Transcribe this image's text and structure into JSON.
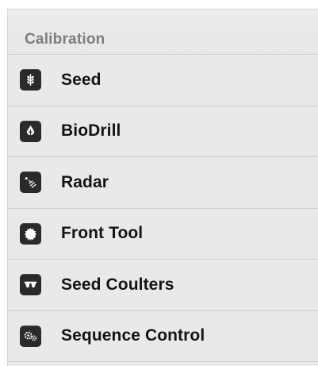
{
  "sidebar": {
    "section_title": "Calibration",
    "items": [
      {
        "label": "Seed",
        "icon": "wheat-icon"
      },
      {
        "label": "BioDrill",
        "icon": "drop-icon"
      },
      {
        "label": "Radar",
        "icon": "radar-icon"
      },
      {
        "label": "Front Tool",
        "icon": "gear-blade-icon"
      },
      {
        "label": "Seed Coulters",
        "icon": "coulter-icon"
      },
      {
        "label": "Sequence Control",
        "icon": "gears-icon"
      }
    ]
  },
  "colors": {
    "panel_background": "#e9e9e9",
    "header_text": "#7d7d7d",
    "item_text": "#141414",
    "icon_background": "#2a2a2a",
    "divider": "#d0d0d0"
  }
}
